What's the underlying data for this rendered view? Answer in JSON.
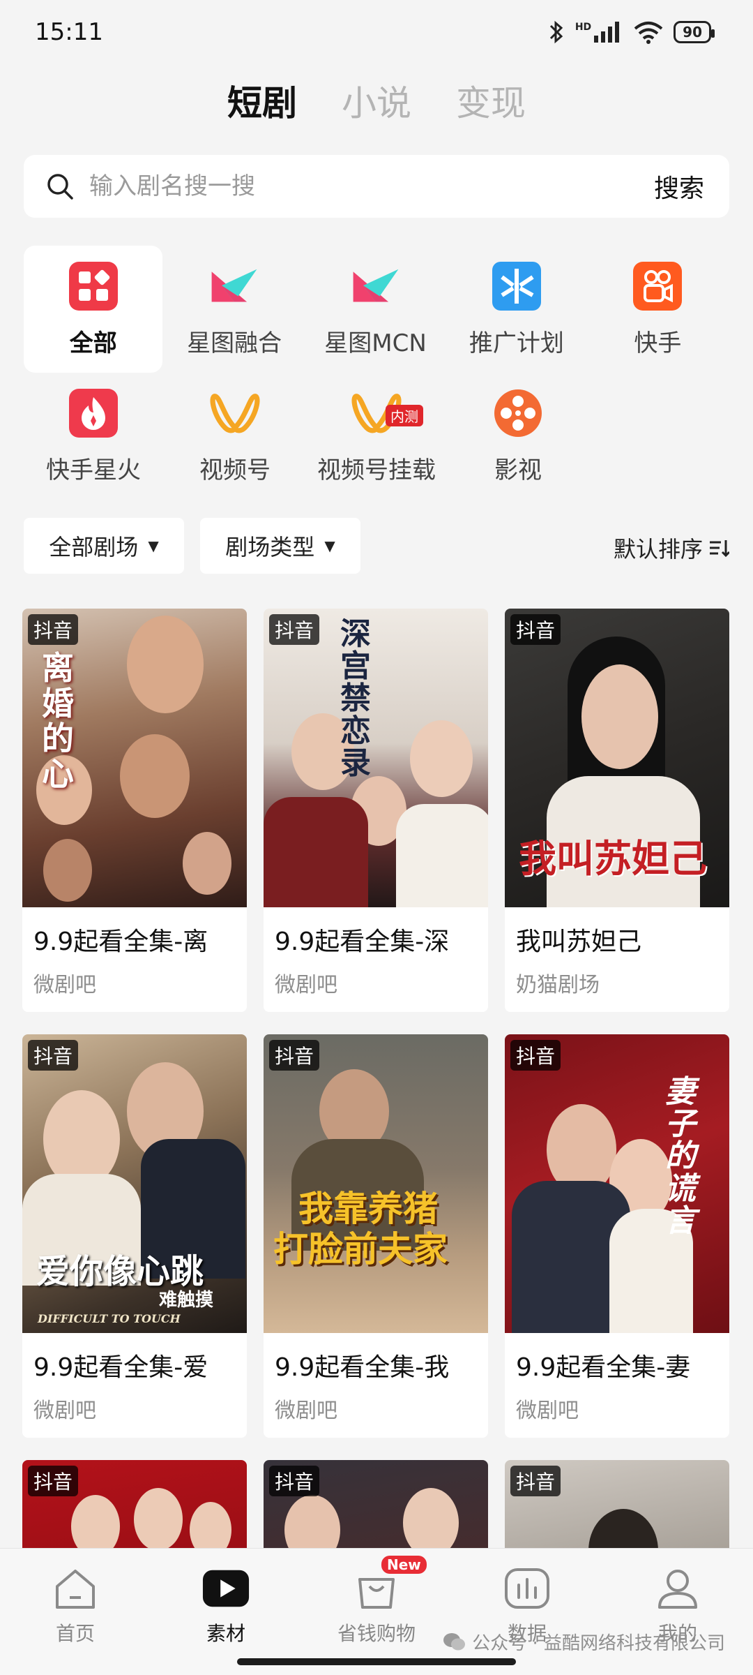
{
  "status_bar": {
    "time": "15:11",
    "network": "HD",
    "battery": "90"
  },
  "top_tabs": [
    {
      "label": "短剧",
      "active": true
    },
    {
      "label": "小说",
      "active": false
    },
    {
      "label": "变现",
      "active": false
    }
  ],
  "search": {
    "placeholder": "输入剧名搜一搜",
    "button": "搜索"
  },
  "categories": [
    {
      "label": "全部",
      "icon": "grid-icon",
      "active": true
    },
    {
      "label": "星图融合",
      "icon": "xingtu-icon"
    },
    {
      "label": "星图MCN",
      "icon": "xingtu-icon"
    },
    {
      "label": "推广计划",
      "icon": "promotion-icon"
    },
    {
      "label": "快手",
      "icon": "kuaishou-icon"
    },
    {
      "label": "快手星火",
      "icon": "kuaishou-xinghuo-icon"
    },
    {
      "label": "视频号",
      "icon": "channels-icon"
    },
    {
      "label": "视频号挂载",
      "icon": "channels-icon",
      "badge": "内测"
    },
    {
      "label": "影视",
      "icon": "film-reel-icon"
    }
  ],
  "filters": {
    "theater": "全部剧场",
    "type": "剧场类型",
    "sort": "默认排序"
  },
  "cards": [
    {
      "tag": "抖音",
      "title": "9.9起看全集-离",
      "source": "微剧吧",
      "poster_text": "离婚的心"
    },
    {
      "tag": "抖音",
      "title": "9.9起看全集-深",
      "source": "微剧吧",
      "poster_text": "深宫禁恋录"
    },
    {
      "tag": "抖音",
      "title": "我叫苏妲己",
      "source": "奶猫剧场",
      "poster_text": "我叫苏妲己"
    },
    {
      "tag": "抖音",
      "title": "9.9起看全集-爱",
      "source": "微剧吧",
      "poster_text": "爱你像心跳",
      "poster_sub": "难触摸",
      "poster_en": "DIFFICULT TO TOUCH"
    },
    {
      "tag": "抖音",
      "title": "9.9起看全集-我",
      "source": "微剧吧",
      "poster_text": "我靠养猪",
      "poster_text2": "打脸前夫家"
    },
    {
      "tag": "抖音",
      "title": "9.9起看全集-妻",
      "source": "微剧吧",
      "poster_text": "妻子的谎言"
    },
    {
      "tag": "抖音"
    },
    {
      "tag": "抖音"
    },
    {
      "tag": "抖音"
    }
  ],
  "bottom_nav": [
    {
      "label": "首页",
      "icon": "home-icon"
    },
    {
      "label": "素材",
      "icon": "play-icon",
      "active": true
    },
    {
      "label": "省钱购物",
      "icon": "shopping-bag-icon",
      "badge": "New"
    },
    {
      "label": "数据",
      "icon": "chart-icon"
    },
    {
      "label": "我的",
      "icon": "profile-icon"
    }
  ],
  "watermark": "公众号 · 益酷网络科技有限公司",
  "colors": {
    "accent_red": "#e0262b",
    "background": "#f4f4f4",
    "card": "#ffffff",
    "tag_bg": "#000000"
  }
}
